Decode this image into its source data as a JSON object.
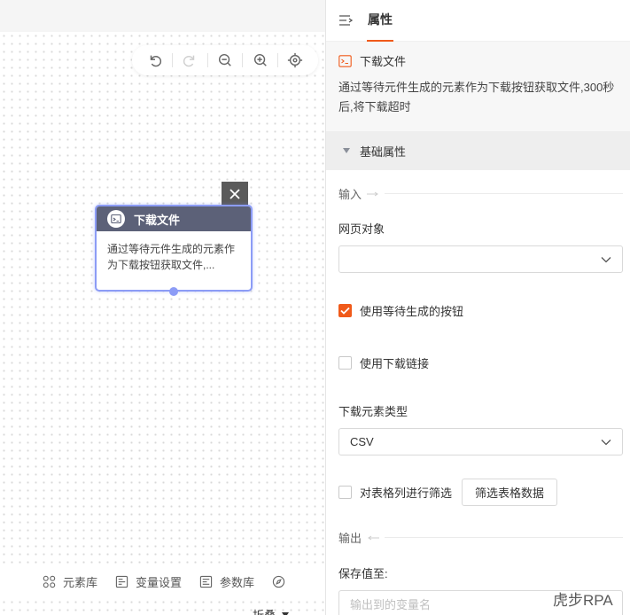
{
  "canvas": {
    "toolbar": {
      "undo_icon": "undo-icon",
      "redo_icon": "redo-icon",
      "zoom_out_icon": "zoom-out-icon",
      "zoom_in_icon": "zoom-in-icon",
      "locate_icon": "target-icon"
    },
    "node": {
      "title": "下载文件",
      "description": "通过等待元件生成的元素作为下载按钮获取文件,...",
      "icon": "terminal-icon"
    },
    "bottom_bar": {
      "items": [
        {
          "label": "元素库",
          "icon": "element-library-icon"
        },
        {
          "label": "变量设置",
          "icon": "variable-settings-icon"
        },
        {
          "label": "参数库",
          "icon": "parameter-library-icon"
        }
      ],
      "extra_icon": "compass-icon",
      "collapse_label": "折叠"
    }
  },
  "panel": {
    "tab_label": "属性",
    "info": {
      "title": "下载文件",
      "description": "通过等待元件生成的元素作为下载按钮获取文件,300秒后,将下载超时"
    },
    "section_title": "基础属性",
    "input_group_label": "输入",
    "web_object_label": "网页对象",
    "web_object_value": "",
    "use_wait_button_label": "使用等待生成的按钮",
    "use_wait_button_checked": true,
    "use_download_link_label": "使用下载链接",
    "use_download_link_checked": false,
    "download_type_label": "下载元素类型",
    "download_type_value": "CSV",
    "filter_columns_label": "对表格列进行筛选",
    "filter_columns_checked": false,
    "filter_button_label": "筛选表格数据",
    "output_group_label": "输出",
    "save_to_label": "保存值至:",
    "save_to_placeholder": "输出到的变量名"
  },
  "watermark": "虎步RPA",
  "colors": {
    "accent": "#f05a1a",
    "node_header": "#5c6178",
    "node_border": "#8c9cf6"
  }
}
